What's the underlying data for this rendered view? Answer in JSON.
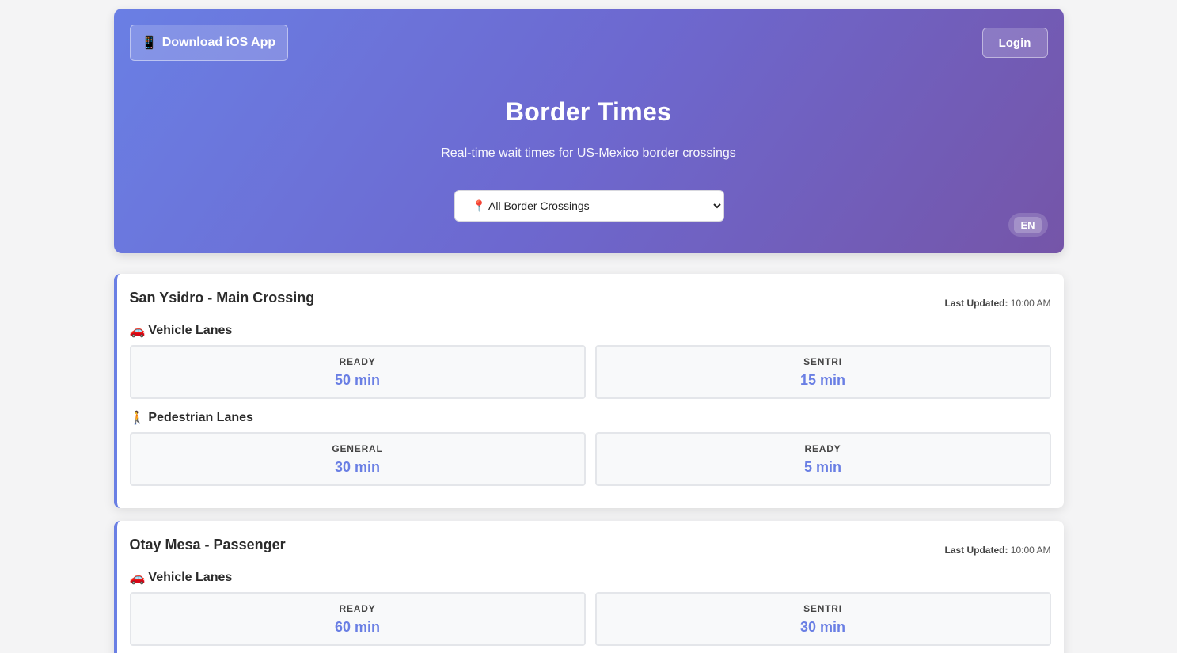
{
  "header": {
    "ios_button_icon": "📱",
    "ios_button_label": "Download iOS App",
    "login_label": "Login",
    "title": "Border Times",
    "subtitle": "Real-time wait times for US-Mexico border crossings",
    "crossing_select": {
      "selected": "📍 All Border Crossings",
      "options": [
        "📍 All Border Crossings"
      ]
    },
    "language": "EN"
  },
  "crossings": [
    {
      "name": "San Ysidro - Main Crossing",
      "updated_label": "Last Updated:",
      "updated_time": "10:00 AM",
      "vehicle": {
        "icon": "🚗",
        "title": "Vehicle Lanes",
        "lanes": [
          {
            "label": "READY",
            "time": "50 min"
          },
          {
            "label": "SENTRI",
            "time": "15 min"
          }
        ]
      },
      "pedestrian": {
        "icon": "🚶",
        "title": "Pedestrian Lanes",
        "lanes": [
          {
            "label": "GENERAL",
            "time": "30 min"
          },
          {
            "label": "READY",
            "time": "5 min"
          }
        ]
      }
    },
    {
      "name": "Otay Mesa - Passenger",
      "updated_label": "Last Updated:",
      "updated_time": "10:00 AM",
      "vehicle": {
        "icon": "🚗",
        "title": "Vehicle Lanes",
        "lanes": [
          {
            "label": "READY",
            "time": "60 min"
          },
          {
            "label": "SENTRI",
            "time": "30 min"
          }
        ]
      }
    }
  ],
  "colors": {
    "accent": "#6a7fe4",
    "header_gradient_start": "#6a7fe4",
    "header_gradient_end": "#7555a8"
  }
}
